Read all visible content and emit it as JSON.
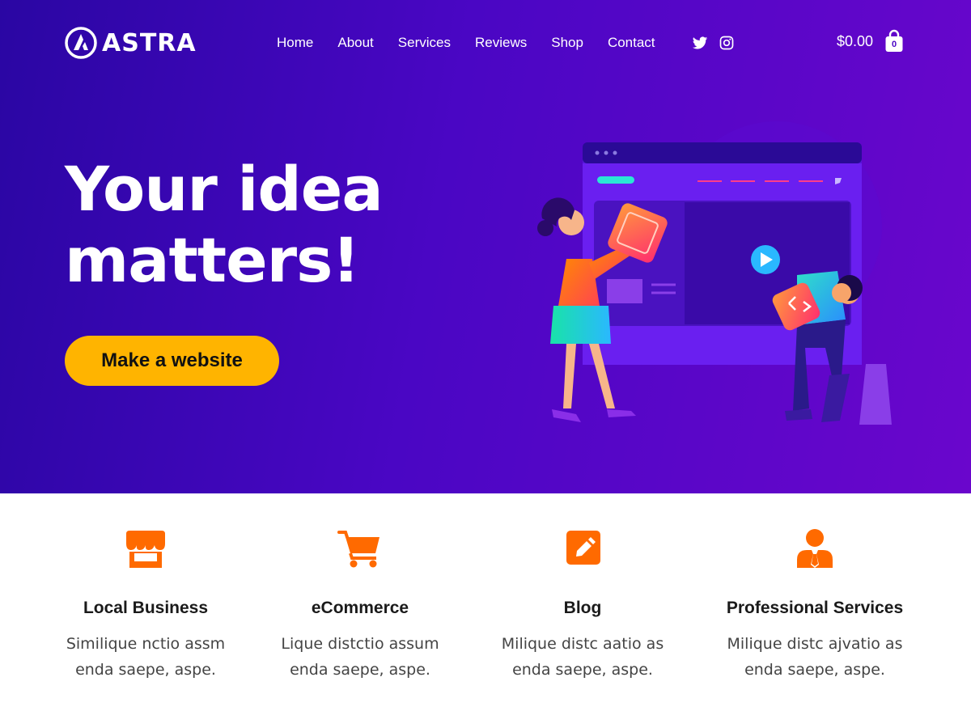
{
  "brand": {
    "name": "ASTRA"
  },
  "nav": {
    "items": [
      "Home",
      "About",
      "Services",
      "Reviews",
      "Shop",
      "Contact"
    ]
  },
  "social": {
    "icons": [
      "twitter-icon",
      "instagram-icon"
    ]
  },
  "cart": {
    "total": "$0.00",
    "count": "0"
  },
  "hero": {
    "title_line1": "Your idea",
    "title_line2": "matters!",
    "cta_label": "Make a website"
  },
  "features": [
    {
      "icon": "storefront-icon",
      "title": "Local Business",
      "text_line1": "Similique nctio assm",
      "text_line2": "enda saepe, aspe."
    },
    {
      "icon": "cart-icon",
      "title": "eCommerce",
      "text_line1": "Lique distctio assum",
      "text_line2": "enda saepe, aspe."
    },
    {
      "icon": "edit-icon",
      "title": "Blog",
      "text_line1": "Milique distc aatio as",
      "text_line2": "enda saepe, aspe."
    },
    {
      "icon": "person-tie-icon",
      "title": "Professional Services",
      "text_line1": "Milique distc ajvatio as",
      "text_line2": "enda saepe, aspe."
    }
  ],
  "colors": {
    "hero_gradient_start": "#2a06a3",
    "hero_gradient_end": "#6a06cc",
    "cta": "#ffb400",
    "accent_icon": "#ff6a00"
  }
}
